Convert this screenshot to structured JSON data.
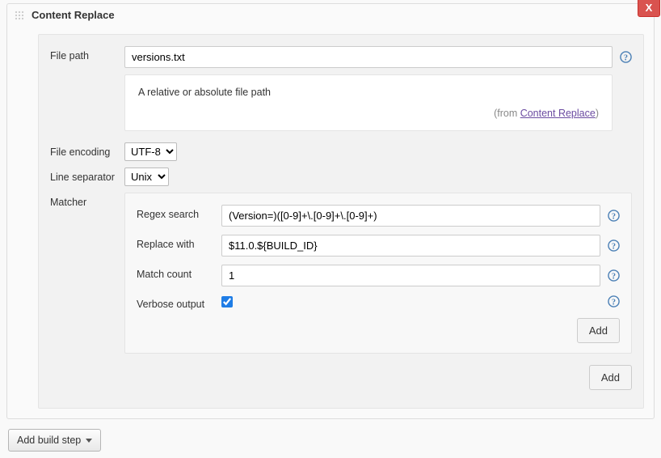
{
  "section": {
    "title": "Content Replace",
    "close_label": "X"
  },
  "file_path": {
    "label": "File path",
    "value": "versions.txt"
  },
  "help": {
    "text": "A relative or absolute file path",
    "from_prefix": "(from ",
    "from_link": "Content Replace",
    "from_suffix": ")"
  },
  "file_encoding": {
    "label": "File encoding",
    "value": "UTF-8"
  },
  "line_separator": {
    "label": "Line separator",
    "value": "Unix"
  },
  "matcher": {
    "label": "Matcher",
    "regex_search": {
      "label": "Regex search",
      "value": "(Version=)([0-9]+\\.[0-9]+\\.[0-9]+)"
    },
    "replace_with": {
      "label": "Replace with",
      "value": "$11.0.${BUILD_ID}"
    },
    "match_count": {
      "label": "Match count",
      "value": "1"
    },
    "verbose": {
      "label": "Verbose output",
      "checked": true
    },
    "add_label": "Add"
  },
  "outer_add_label": "Add",
  "footer": {
    "add_build_step": "Add build step"
  }
}
